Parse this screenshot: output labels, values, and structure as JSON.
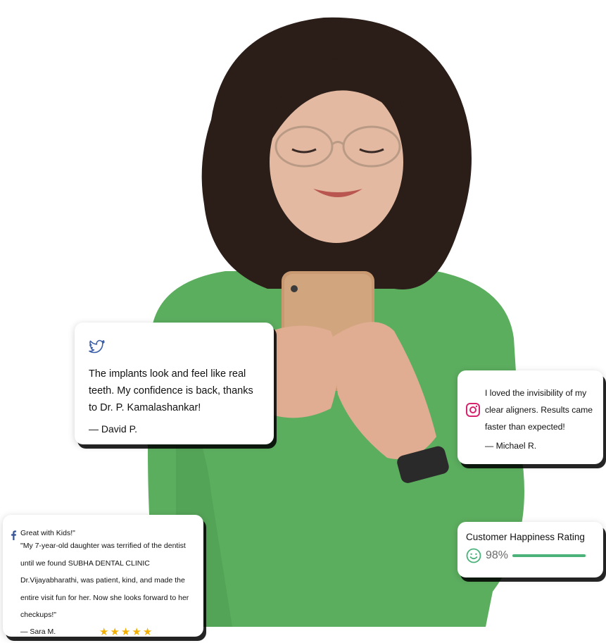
{
  "colors": {
    "sweater": "#5cae5f",
    "hair": "#2b1d18",
    "skin": "#e3b9a2",
    "phone": "#c99a72",
    "rating_bar": "#4bb27a",
    "star": "#f4b000",
    "twitter": "#3b5fa8",
    "instagram": "#d6246e",
    "facebook": "#3b5998"
  },
  "cards": {
    "twitter": {
      "icon": "twitter-bird-icon",
      "quote": "The implants look and feel like real teeth. My confidence is back, thanks to Dr. P. Kamalashankar!",
      "author": "— David P."
    },
    "instagram": {
      "icon": "instagram-icon",
      "quote": "I loved the invisibility of my clear aligners. Results came faster than expected!",
      "author": "— Michael R."
    },
    "facebook": {
      "icon": "facebook-icon",
      "heading": "Great with Kids!\"",
      "quote": "\"My 7-year-old daughter was terrified of the dentist until we found SUBHA DENTAL CLINIC Dr.Vijayabharathi, was patient, kind, and made the entire visit fun for her. Now she looks forward to her checkups!\"",
      "author": "—  Sara M.",
      "stars": 5
    },
    "rating": {
      "title": "Customer Happiness Rating",
      "icon": "smiley-icon",
      "percent_label": "98%",
      "percent": 98
    }
  }
}
